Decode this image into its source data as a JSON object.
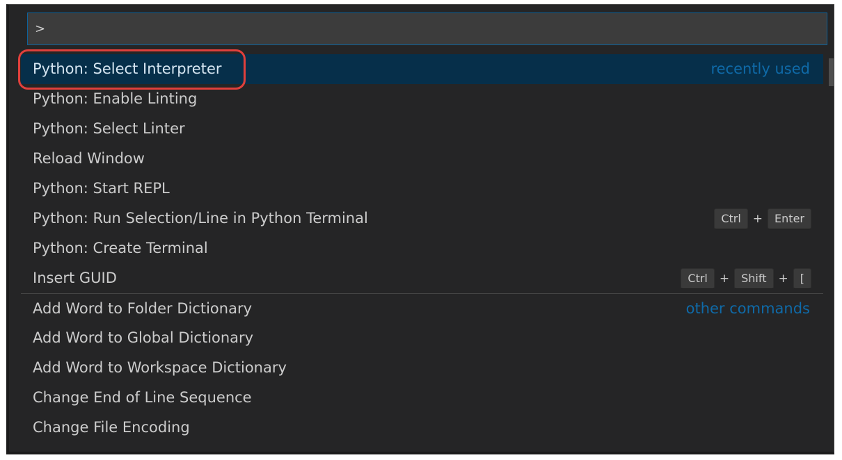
{
  "quick_open": {
    "input_value": ">",
    "items": [
      {
        "label": "Python: Select Interpreter",
        "tag": "recently used"
      },
      {
        "label": "Python: Enable Linting"
      },
      {
        "label": "Python: Select Linter"
      },
      {
        "label": "Reload Window"
      },
      {
        "label": "Python: Start REPL"
      },
      {
        "label": "Python: Run Selection/Line in Python Terminal",
        "keys": [
          "Ctrl",
          "+",
          "Enter"
        ]
      },
      {
        "label": "Python: Create Terminal"
      },
      {
        "label": "Insert GUID",
        "keys": [
          "Ctrl",
          "+",
          "Shift",
          "+",
          "["
        ]
      },
      {
        "label": "Add Word to Folder Dictionary",
        "tag": "other commands"
      },
      {
        "label": "Add Word to Global Dictionary"
      },
      {
        "label": "Add Word to Workspace Dictionary"
      },
      {
        "label": "Change End of Line Sequence"
      },
      {
        "label": "Change File Encoding"
      }
    ]
  },
  "colors": {
    "background": "#252526",
    "active_row": "#062f4a",
    "tag_text": "#0f6aa8",
    "highlight_ring": "#e0403c",
    "input_border": "#0e639c"
  }
}
